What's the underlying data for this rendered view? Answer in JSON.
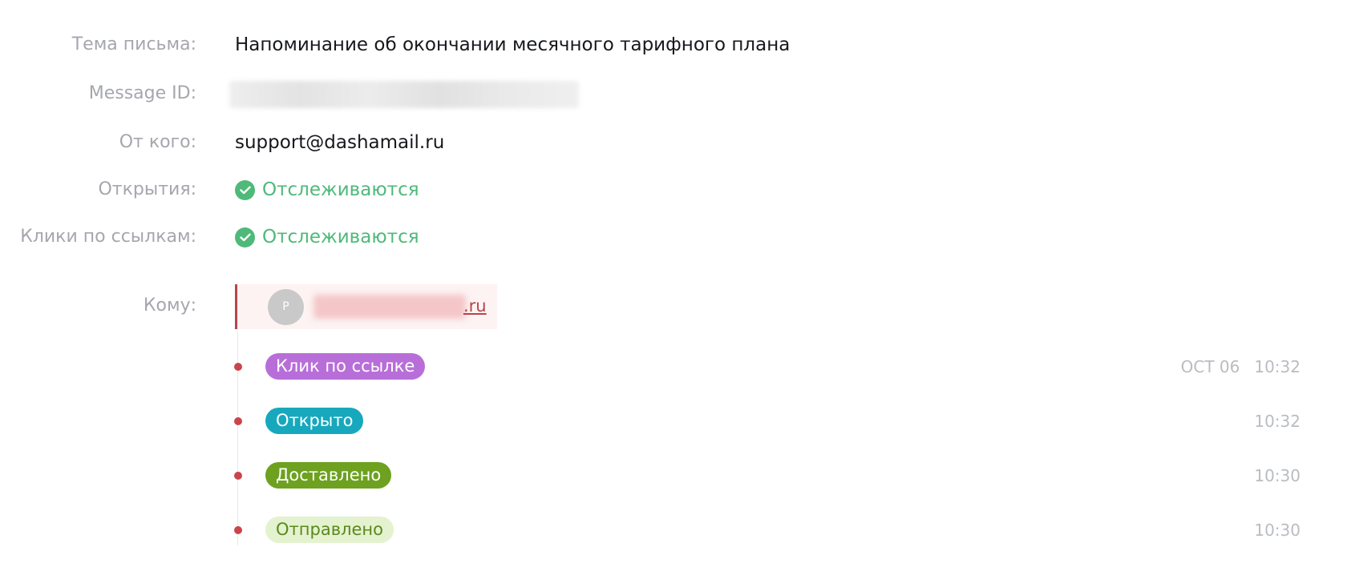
{
  "fields": {
    "subject": {
      "label": "Тема письма:",
      "value": "Напоминание об окончании месячного тарифного плана"
    },
    "message_id": {
      "label": "Message ID:"
    },
    "from": {
      "label": "От кого:",
      "value": "support@dashamail.ru"
    },
    "opens": {
      "label": "Открытия:",
      "status": "Отслеживаются"
    },
    "clicks": {
      "label": "Клики по ссылкам:",
      "status": "Отслеживаются"
    },
    "to": {
      "label": "Кому:",
      "avatar_letter": "P",
      "email_visible_suffix": ".ru"
    }
  },
  "events": [
    {
      "label": "Клик по ссылке",
      "date": "OCT 06",
      "time": "10:32"
    },
    {
      "label": "Открыто",
      "date": "",
      "time": "10:32"
    },
    {
      "label": "Доставлено",
      "date": "",
      "time": "10:30"
    },
    {
      "label": "Отправлено",
      "date": "",
      "time": "10:30"
    }
  ],
  "colors": {
    "tracked_green": "#4fb97a",
    "accent_red": "#b8444b",
    "click_pill": "#b86ed8",
    "opened_pill": "#17a8bd",
    "delivered_pill": "#6da11f",
    "sent_pill_bg": "#e4f2cf",
    "sent_pill_text": "#5a8a1d"
  },
  "icons": {
    "tracked": "check-circle-icon"
  }
}
